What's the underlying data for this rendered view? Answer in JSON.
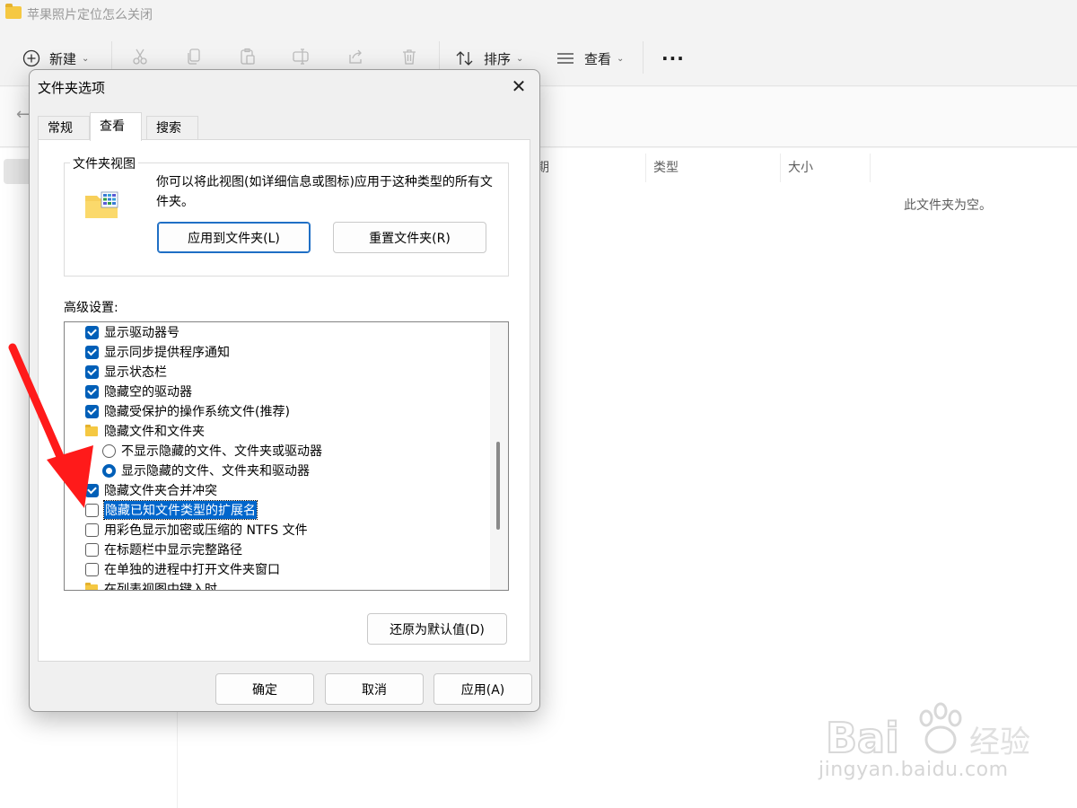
{
  "window": {
    "title": "苹果照片定位怎么关闭"
  },
  "toolbar": {
    "new_label": "新建",
    "sort_label": "排序",
    "view_label": "查看",
    "more_label": "···"
  },
  "columns": [
    "期",
    "类型",
    "大小"
  ],
  "empty_message": "此文件夹为空。",
  "dialog": {
    "title": "文件夹选项",
    "close": "✕",
    "tabs": [
      "常规",
      "查看",
      "搜索"
    ],
    "active_tab": "查看",
    "folder_views": {
      "label": "文件夹视图",
      "description": "你可以将此视图(如详细信息或图标)应用于这种类型的所有文件夹。",
      "apply_button": "应用到文件夹(L)",
      "reset_button": "重置文件夹(R)"
    },
    "advanced": {
      "label": "高级设置:",
      "items": [
        {
          "type": "checkbox",
          "checked": true,
          "label": "显示驱动器号"
        },
        {
          "type": "checkbox",
          "checked": true,
          "label": "显示同步提供程序通知"
        },
        {
          "type": "checkbox",
          "checked": true,
          "label": "显示状态栏"
        },
        {
          "type": "checkbox",
          "checked": true,
          "label": "隐藏空的驱动器"
        },
        {
          "type": "checkbox",
          "checked": true,
          "label": "隐藏受保护的操作系统文件(推荐)"
        },
        {
          "type": "folder",
          "label": "隐藏文件和文件夹"
        },
        {
          "type": "radio",
          "checked": false,
          "label": "不显示隐藏的文件、文件夹或驱动器"
        },
        {
          "type": "radio",
          "checked": true,
          "label": "显示隐藏的文件、文件夹和驱动器"
        },
        {
          "type": "checkbox",
          "checked": true,
          "label": "隐藏文件夹合并冲突"
        },
        {
          "type": "checkbox",
          "checked": false,
          "selected": true,
          "label": "隐藏已知文件类型的扩展名"
        },
        {
          "type": "checkbox",
          "checked": false,
          "label": "用彩色显示加密或压缩的 NTFS 文件"
        },
        {
          "type": "checkbox",
          "checked": false,
          "label": "在标题栏中显示完整路径"
        },
        {
          "type": "checkbox",
          "checked": false,
          "label": "在单独的进程中打开文件夹窗口"
        },
        {
          "type": "folder",
          "label": "在列表视图中键入时"
        }
      ]
    },
    "restore_button": "还原为默认值(D)",
    "ok_button": "确定",
    "cancel_button": "取消",
    "apply_button": "应用(A)"
  },
  "watermark": {
    "brand": "Bai du 经验",
    "url": "jingyan.baidu.com"
  },
  "colors": {
    "accent": "#005fb8",
    "arrow": "#ff1a1a",
    "selection": "#0066cc"
  }
}
